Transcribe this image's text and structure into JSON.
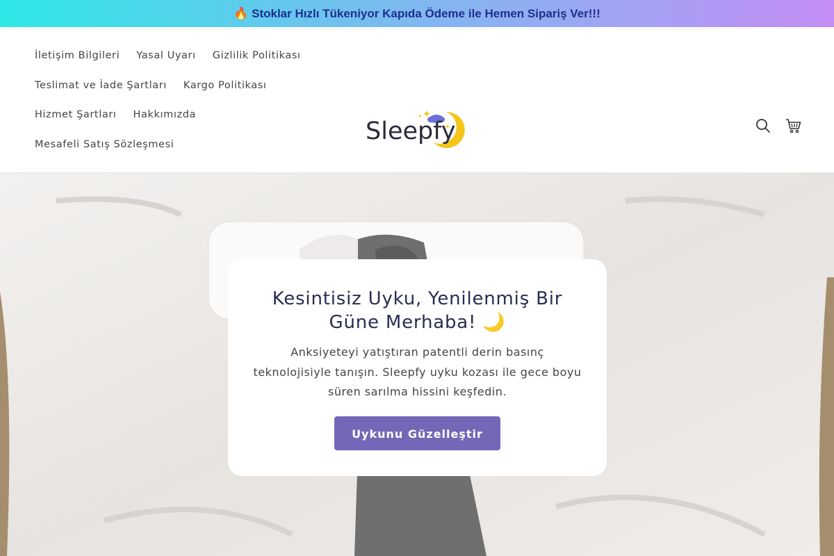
{
  "announcement": {
    "text": "🔥 Stoklar Hızlı Tükeniyor Kapıda Ödeme ile Hemen Sipariş Ver!!!"
  },
  "nav": {
    "rows": [
      [
        "İletişim Bilgileri",
        "Yasal Uyarı",
        "Gizlilik Politikası"
      ],
      [
        "Teslimat ve İade Şartları",
        "Kargo Politikası"
      ],
      [
        "Hizmet Şartları",
        "Hakkımızda"
      ],
      [
        "Mesafeli Satış Sözleşmesi"
      ]
    ]
  },
  "logo": {
    "text": "Sleepfy"
  },
  "header_icons": {
    "search": "search-icon",
    "cart": "cart-icon"
  },
  "hero": {
    "heading": "Kesintisiz Uyku, Yenilenmiş Bir Güne Merhaba! 🌙",
    "body": "Anksiyeteyi yatıştıran patentli derin basınç teknolojisiyle tanışın. Sleepfy uyku kozası ile gece boyu süren sarılma hissini keşfedin.",
    "cta_label": "Uykunu Güzelleştir"
  },
  "colors": {
    "accent": "#7467b8",
    "heading": "#2b2d52",
    "announcement_text": "#1e2f8c",
    "moon": "#f5c518"
  }
}
